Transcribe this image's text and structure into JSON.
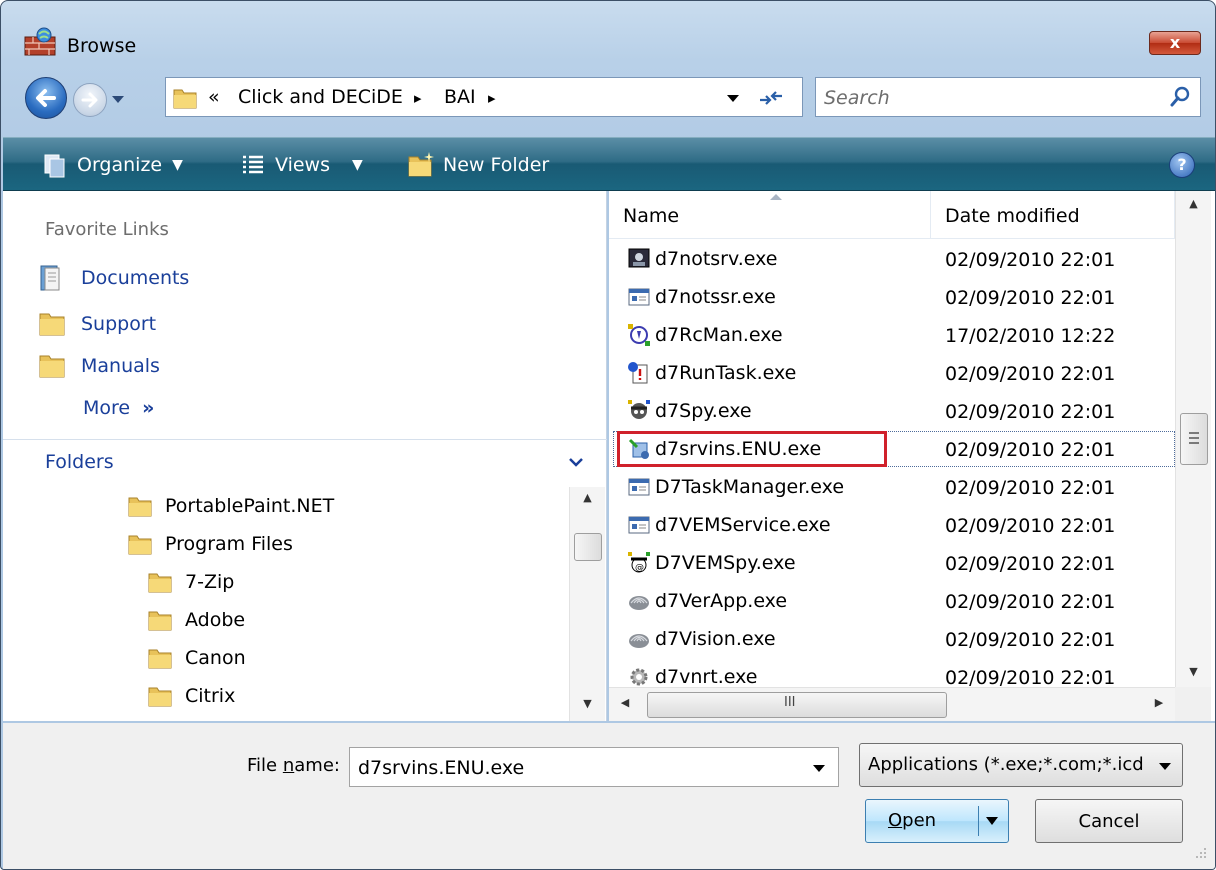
{
  "window": {
    "title": "Browse",
    "close_label": "x"
  },
  "address": {
    "overflow": "«",
    "crumbs": [
      "Click and DECiDE",
      "BAI"
    ],
    "separator": "▸"
  },
  "search": {
    "placeholder": "Search"
  },
  "toolbar": {
    "organize": "Organize",
    "views": "Views",
    "new_folder": "New Folder",
    "help": "?"
  },
  "nav": {
    "favorites_heading": "Favorite Links",
    "links": [
      "Documents",
      "Support",
      "Manuals"
    ],
    "more": "More",
    "more_glyph": "»",
    "folders_heading": "Folders",
    "tree": [
      {
        "label": "PortablePaint.NET",
        "level": 0
      },
      {
        "label": "Program Files",
        "level": 0
      },
      {
        "label": "7-Zip",
        "level": 1
      },
      {
        "label": "Adobe",
        "level": 1
      },
      {
        "label": "Canon",
        "level": 1
      },
      {
        "label": "Citrix",
        "level": 1
      }
    ]
  },
  "files": {
    "columns": {
      "name": "Name",
      "date": "Date modified"
    },
    "rows": [
      {
        "name": "d7notsrv.exe",
        "date": "02/09/2010 22:01",
        "icon": "monitor-app-icon"
      },
      {
        "name": "d7notssr.exe",
        "date": "02/09/2010 22:01",
        "icon": "window-app-icon"
      },
      {
        "name": "d7RcMan.exe",
        "date": "17/02/2010 12:22",
        "icon": "remote-control-icon"
      },
      {
        "name": "d7RunTask.exe",
        "date": "02/09/2010 22:01",
        "icon": "task-alert-icon"
      },
      {
        "name": "d7Spy.exe",
        "date": "02/09/2010 22:01",
        "icon": "spy-icon"
      },
      {
        "name": "d7srvins.ENU.exe",
        "date": "02/09/2010 22:01",
        "icon": "installer-icon",
        "selected": true
      },
      {
        "name": "D7TaskManager.exe",
        "date": "02/09/2010 22:01",
        "icon": "window-app-icon"
      },
      {
        "name": "d7VEMService.exe",
        "date": "02/09/2010 22:01",
        "icon": "window-app-icon"
      },
      {
        "name": "D7VEMSpy.exe",
        "date": "02/09/2010 22:01",
        "icon": "vem-spy-icon"
      },
      {
        "name": "d7VerApp.exe",
        "date": "02/09/2010 22:01",
        "icon": "shell-icon"
      },
      {
        "name": "d7Vision.exe",
        "date": "02/09/2010 22:01",
        "icon": "shell-icon"
      },
      {
        "name": "d7vnrt.exe",
        "date": "02/09/2010 22:01",
        "icon": "gear-app-icon"
      }
    ],
    "hscroll_grip": "III"
  },
  "bottom": {
    "file_name_label_pre": "File ",
    "file_name_label_key": "n",
    "file_name_label_post": "ame:",
    "file_name_value": "d7srvins.ENU.exe",
    "file_type": "Applications (*.exe;*.com;*.icd",
    "open_key": "O",
    "open_rest": "pen",
    "cancel": "Cancel"
  },
  "colors": {
    "link": "#1a3f9a",
    "toolbar": "#1b6680",
    "highlight_box": "#d0212b",
    "close": "#c94a32"
  }
}
